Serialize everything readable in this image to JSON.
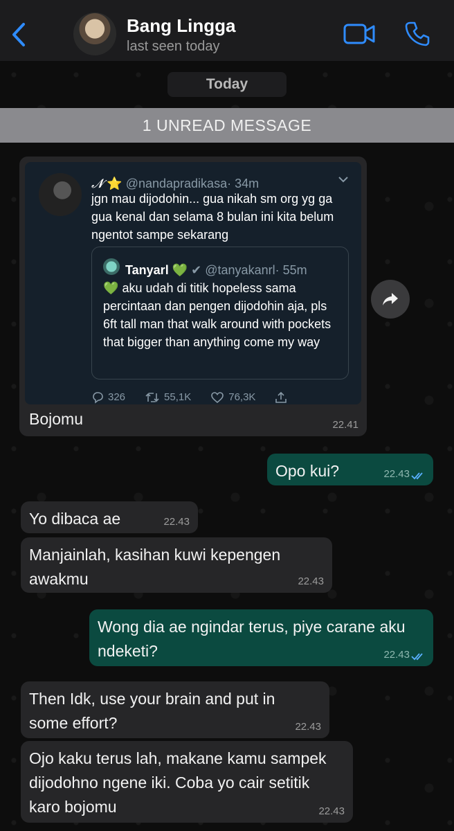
{
  "header": {
    "contact_name": "Bang Lingga",
    "status": "last seen today"
  },
  "date_chip": "Today",
  "unread_banner": "1 UNREAD MESSAGE",
  "tweet": {
    "author_symbol": "𝓝",
    "author_emoji": "⭐",
    "handle": "@nandapradikasa",
    "age": "· 34m",
    "text": "jgn mau dijodohin... gua nikah sm org yg ga gua kenal dan selama 8 bulan ini kita belum ngentot sampe sekarang",
    "quote": {
      "name": "Tanyarl",
      "heart": "💚",
      "handle": "@tanyakanrl",
      "age": "· 55m",
      "heart_prefix": "💚",
      "text": "aku udah di titik hopeless sama percintaan dan pengen dijodohin aja, pls 6ft tall man that walk around with pockets that bigger than anything come my way"
    },
    "stats": {
      "replies": "326",
      "retweets": "55,1K",
      "likes": "76,3K"
    },
    "caption": "Bojomu",
    "time": "22.41"
  },
  "messages": [
    {
      "dir": "out",
      "text": "Opo kui?",
      "time": "22.43"
    },
    {
      "dir": "in",
      "text": "Yo dibaca ae",
      "time": "22.43"
    },
    {
      "dir": "in",
      "text": "Manjainlah, kasihan kuwi kepengen awakmu",
      "time": "22.43"
    },
    {
      "dir": "out",
      "text": "Wong dia ae ngindar terus, piye carane aku ndeketi?",
      "time": "22.43"
    },
    {
      "dir": "in",
      "text": "Then Idk, use your brain and put in some effort?",
      "time": "22.43"
    },
    {
      "dir": "in",
      "text": "Ojo kaku terus lah, makane kamu sampek dijodohno ngene iki. Coba yo cair setitik karo bojomu",
      "time": "22.43"
    }
  ],
  "colors": {
    "accent": "#2f8cff",
    "incoming_bubble": "#262628",
    "outgoing_bubble": "#0b4a40",
    "read_ticks": "#5ab0ff"
  }
}
